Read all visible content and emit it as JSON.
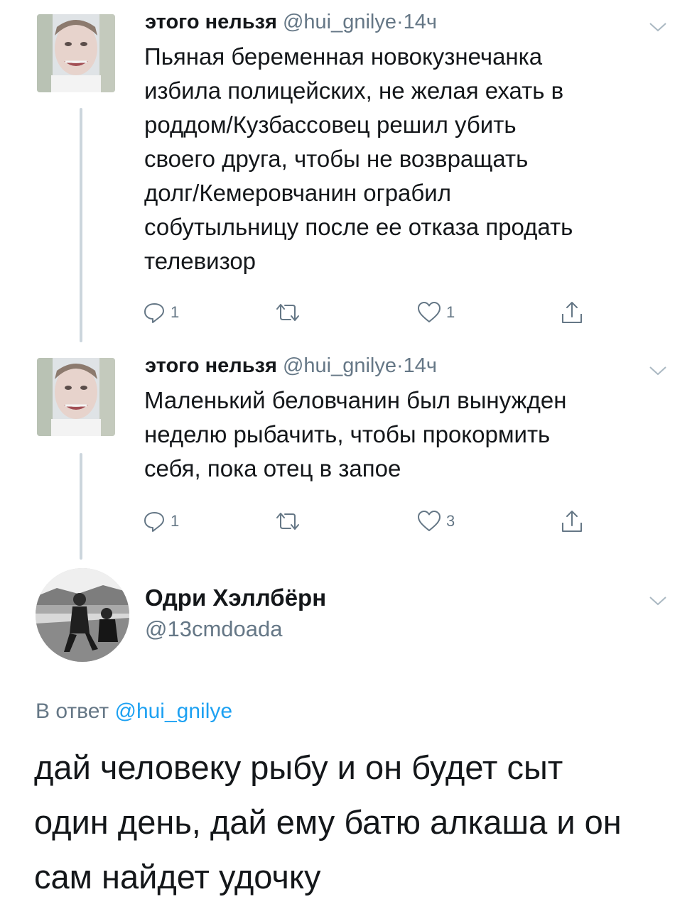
{
  "tweets": [
    {
      "name": "этого нельзя",
      "handle": "@hui_gnilye",
      "dot": "·",
      "time": "14ч",
      "lines": [
        "Пьяная беременная новокузнечанка",
        "избила полицейских, не желая ехать в",
        "роддом/Кузбассовец решил убить",
        "своего друга, чтобы не возвращать",
        "долг/Кемеровчанин ограбил",
        "собутыльницу после ее отказа продать",
        "телевизор"
      ],
      "reply_count": "1",
      "retweet_count": "",
      "like_count": "1"
    },
    {
      "name": "этого нельзя",
      "handle": "@hui_gnilye",
      "dot": "·",
      "time": "14ч",
      "lines": [
        "Маленький беловчанин был вынужден",
        "неделю рыбачить, чтобы прокормить",
        "себя, пока отец в запое"
      ],
      "reply_count": "1",
      "retweet_count": "",
      "like_count": "3"
    }
  ],
  "main_tweet": {
    "name": "Одри Хэллбёрн",
    "handle": "@13cmdoada",
    "reply_prefix": "В ответ",
    "reply_mention": "@hui_gnilye",
    "lines": [
      "дай человеку рыбу и он будет сыт",
      "один день, дай ему батю алкаша и он",
      "сам найдет удочку"
    ]
  },
  "icons": {
    "reply": "reply-icon",
    "retweet": "retweet-icon",
    "like": "heart-icon",
    "share": "share-icon",
    "menu": "chevron-down-icon"
  },
  "colors": {
    "text": "#14171a",
    "secondary": "#657786",
    "link": "#1da1f2",
    "thread_line": "#ccd6dd"
  }
}
